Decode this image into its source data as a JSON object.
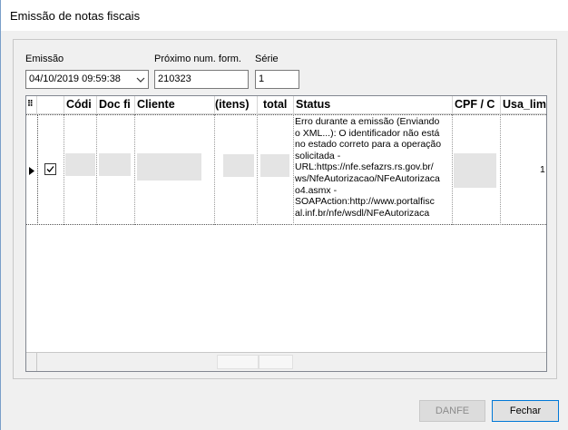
{
  "window": {
    "title": "Emissão de notas fiscais"
  },
  "form": {
    "emissao_label": "Emissão",
    "emissao_value": "04/10/2019 09:59:38",
    "proximo_label": "Próximo num. form.",
    "proximo_value": "210323",
    "serie_label": "Série",
    "serie_value": "1"
  },
  "grid": {
    "columns": [
      {
        "key": "indicator",
        "label": "⠿"
      },
      {
        "key": "check",
        "label": ""
      },
      {
        "key": "codigo",
        "label": "Códi"
      },
      {
        "key": "doc",
        "label": "Doc fi"
      },
      {
        "key": "cliente",
        "label": "Cliente"
      },
      {
        "key": "itens",
        "label": "(itens)"
      },
      {
        "key": "total",
        "label": "total"
      },
      {
        "key": "status",
        "label": "Status"
      },
      {
        "key": "cpf",
        "label": "CPF / C"
      },
      {
        "key": "usa_lim",
        "label": "Usa_lim"
      }
    ],
    "rows": [
      {
        "checked": true,
        "status": "Erro durante a emissão (Enviando\no XML...): O identificador não está\nno estado correto para a operação\nsolicitada -\nURL:https://nfe.sefazrs.rs.gov.br/\nws/NfeAutorizacao/NFeAutorizaca\no4.asmx -\nSOAPAction:http://www.portalfisc\nal.inf.br/nfe/wsdl/NFeAutorizaca",
        "usa_lim": "1"
      }
    ]
  },
  "buttons": {
    "danfe": "DANFE",
    "fechar": "Fechar"
  }
}
